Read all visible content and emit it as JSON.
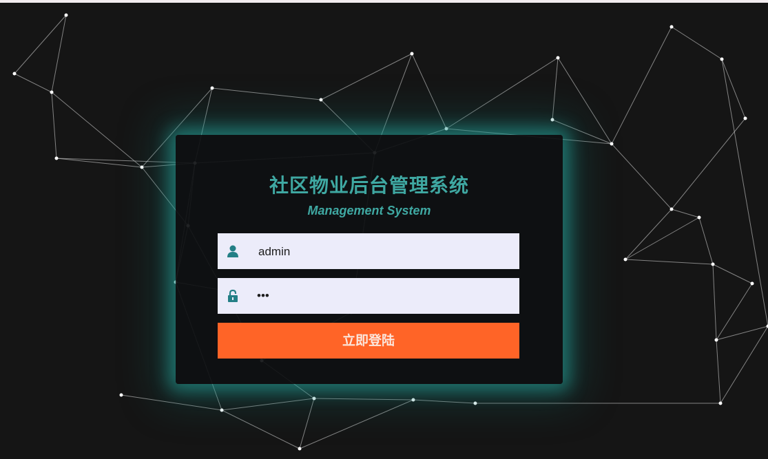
{
  "login": {
    "title": "社区物业后台管理系统",
    "subtitle": "Management System",
    "username": {
      "value": "admin",
      "icon": "user-icon"
    },
    "password": {
      "value": "•••",
      "icon": "lock-icon"
    },
    "submit_label": "立即登陆"
  },
  "colors": {
    "accent": "#3fa8a2",
    "button": "#ff6427",
    "input_bg": "#ececfa",
    "background": "#151515"
  }
}
